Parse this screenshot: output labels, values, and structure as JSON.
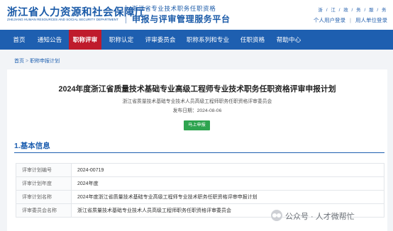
{
  "header": {
    "org_name": "浙江省人力资源和社会保障厅",
    "org_name_en": "ZHEJIANG HUMAN RESOURCES AND SOCIAL SECURITY DEPARTMENT",
    "system_subtitle": "浙江省专业技术职务任职资格",
    "system_title": "申报与评审管理服务平台",
    "locale": "浙 / 江 / 政 / 务 / 服 / 务",
    "personal_login": "个人用户登录",
    "employer_login": "用人单位登录"
  },
  "nav": {
    "items": [
      {
        "label": "首页",
        "active": false
      },
      {
        "label": "通知公告",
        "active": false
      },
      {
        "label": "职称评审",
        "active": true
      },
      {
        "label": "职称认定",
        "active": false
      },
      {
        "label": "评审委员会",
        "active": false
      },
      {
        "label": "职称系列和专业",
        "active": false
      },
      {
        "label": "任职资格",
        "active": false
      },
      {
        "label": "帮助中心",
        "active": false
      }
    ]
  },
  "breadcrumb": {
    "home": "首页",
    "separator": ">",
    "current": "职称申报计划"
  },
  "detail": {
    "title": "2024年度浙江省质量技术基础专业高级工程师专业技术职务任职资格评审申报计划",
    "organizer": "浙江省质量技术基础专业技术人员高级工程师职务任职资格评审委员会",
    "published": "发布日期：2024-08-06",
    "apply_button": "马上申报"
  },
  "basic_info": {
    "section_title": "1.基本信息",
    "rows": [
      {
        "label": "评审计划编号",
        "value": "2024-00719"
      },
      {
        "label": "评审计划年度",
        "value": "2024年度"
      },
      {
        "label": "评审计划名称",
        "value": "2024年度浙江省质量技术基础专业高级工程师专业技术职务任职资格评审申报计划"
      },
      {
        "label": "评审委员会名称",
        "value": "浙江省质量技术基础专业技术人员高级工程师职务任职资格评审委员会"
      }
    ]
  },
  "watermark": {
    "text": "公众号 · 人才微帮忙"
  },
  "colors": {
    "brand_blue": "#1e5fb0",
    "active_red": "#bf1b2c",
    "apply_green": "#2ea44f"
  }
}
